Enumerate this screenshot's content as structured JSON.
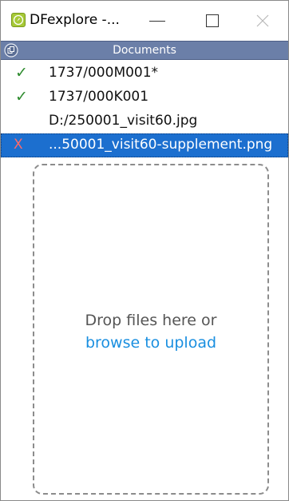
{
  "window": {
    "title": "DFexplore -...",
    "icon": "compass-icon"
  },
  "documents": {
    "header_title": "Documents",
    "header_icon": "copy-icon",
    "items": [
      {
        "status": "✓",
        "status_meaning": "ok",
        "label": "1737/000M001*"
      },
      {
        "status": "✓",
        "status_meaning": "ok",
        "label": "1737/000K001"
      },
      {
        "status": "",
        "status_meaning": "none",
        "label": "D:/250001_visit60.jpg"
      },
      {
        "status": "X",
        "status_meaning": "error",
        "label": "...50001_visit60-supplement.png",
        "selected": true
      }
    ]
  },
  "dropzone": {
    "text": "Drop files here or",
    "link_text": "browse to upload"
  },
  "colors": {
    "header_bg": "#6b7fa8",
    "selection_bg": "#1c6fcf",
    "check_green": "#2e8b2e",
    "error_red": "#ff6a6a",
    "link_blue": "#1a8fe0"
  }
}
